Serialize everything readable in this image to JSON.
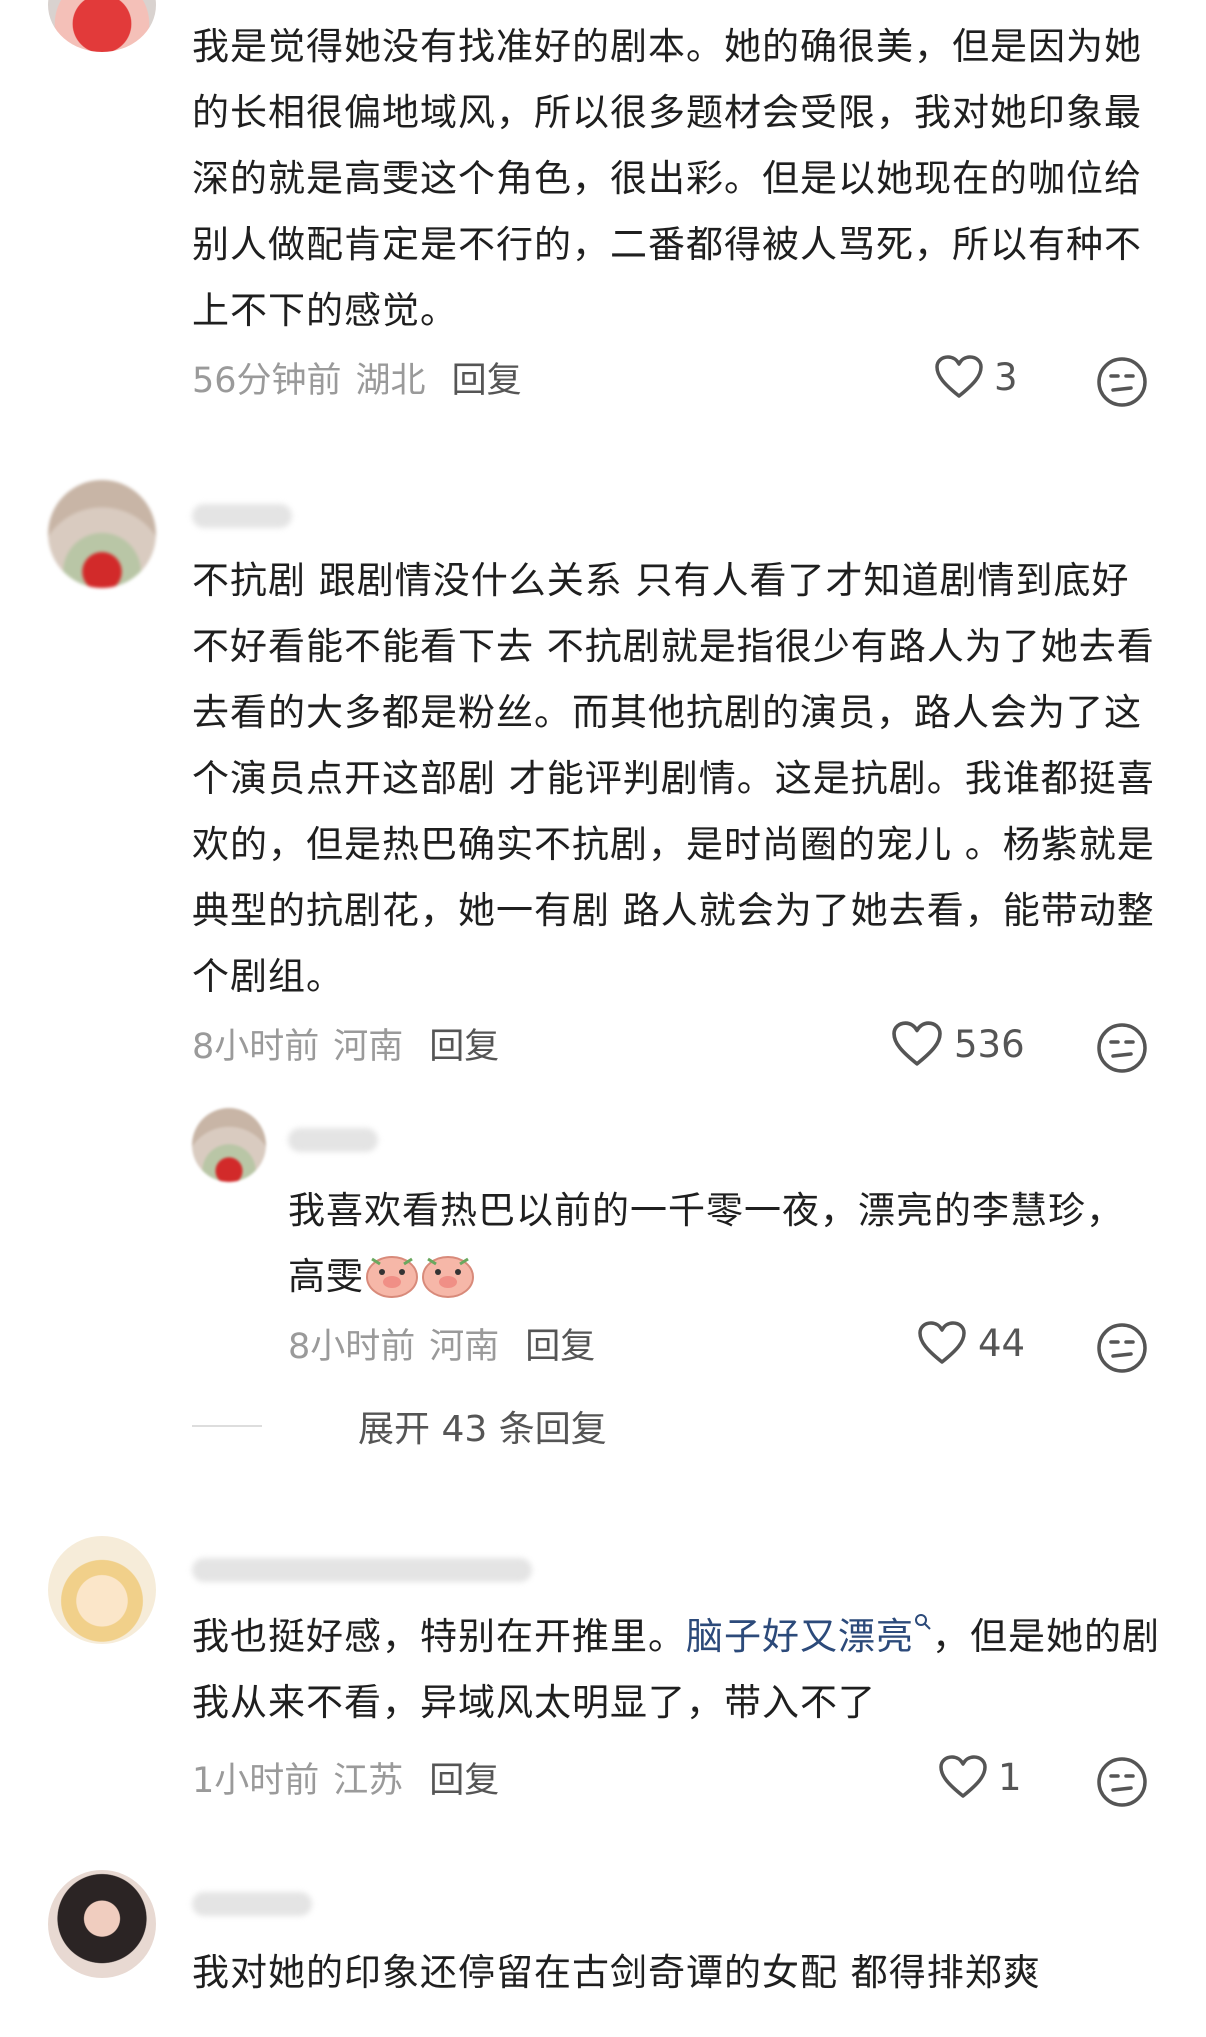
{
  "comments": [
    {
      "text": "我是觉得她没有找准好的剧本。她的确很美，但是因为她的长相很偏地域风，所以很多题材会受限，我对她印象最深的就是高雯这个角色，很出彩。但是以她现在的咖位给别人做配肯定是不行的，二番都得被人骂死，所以有种不上不下的感觉。",
      "time": "56分钟前",
      "location": "湖北",
      "reply_label": "回复",
      "likes": "3"
    },
    {
      "text": "不抗剧 跟剧情没什么关系 只有人看了才知道剧情到底好不好看能不能看下去 不抗剧就是指很少有路人为了她去看 去看的大多都是粉丝。而其他抗剧的演员，路人会为了这个演员点开这部剧 才能评判剧情。这是抗剧。我谁都挺喜欢的，但是热巴确实不抗剧，是时尚圈的宠儿 。杨紫就是典型的抗剧花，她一有剧 路人就会为了她去看，能带动整个剧组。",
      "time": "8小时前",
      "location": "河南",
      "reply_label": "回复",
      "likes": "536",
      "reply": {
        "text": "我喜欢看热巴以前的一千零一夜，漂亮的李慧珍，高雯",
        "time": "8小时前",
        "location": "河南",
        "reply_label": "回复",
        "likes": "44"
      },
      "expand_label": "展开 43 条回复"
    },
    {
      "text_before": "我也挺好感，特别在开推里。",
      "link_text": "脑子好又漂亮",
      "text_after": "，但是她的剧我从来不看，异域风太明显了，带入不了",
      "time": "1小时前",
      "location": "江苏",
      "reply_label": "回复",
      "likes": "1"
    },
    {
      "text": "我对她的印象还停留在古剑奇谭的女配 都得排郑爽"
    }
  ]
}
